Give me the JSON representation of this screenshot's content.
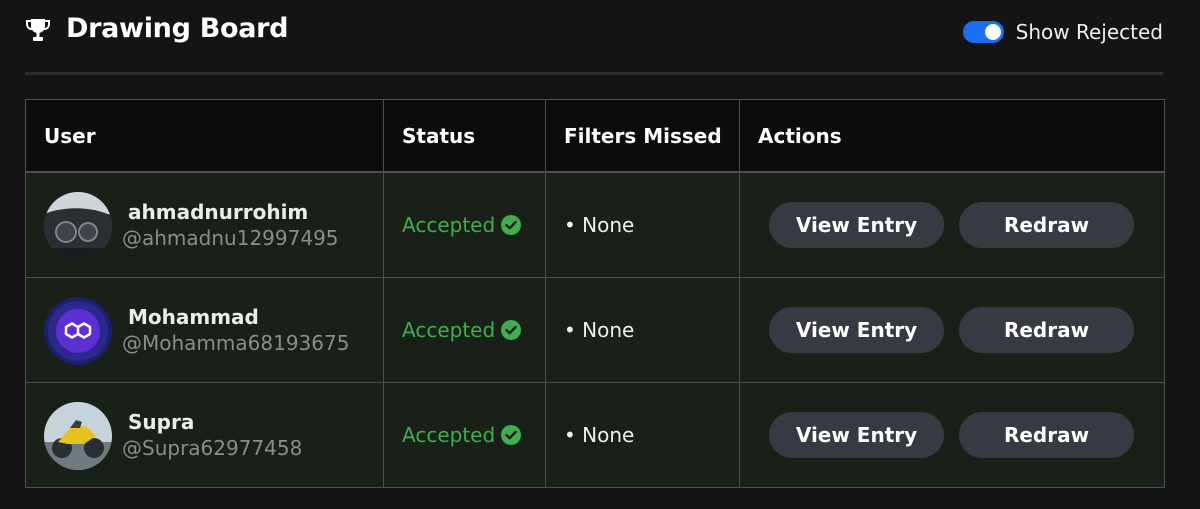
{
  "header": {
    "title": "Drawing Board",
    "toggle_label": "Show Rejected",
    "toggle_on": true
  },
  "table": {
    "columns": [
      "User",
      "Status",
      "Filters Missed",
      "Actions"
    ],
    "rows": [
      {
        "name": "ahmadnurrohim",
        "handle": "@ahmadnu12997495",
        "status": "Accepted",
        "filters": "• None",
        "view_label": "View Entry",
        "redraw_label": "Redraw"
      },
      {
        "name": "Mohammad",
        "handle": "@Mohamma68193675",
        "status": "Accepted",
        "filters": "• None",
        "view_label": "View Entry",
        "redraw_label": "Redraw"
      },
      {
        "name": "Supra",
        "handle": "@Supra62977458",
        "status": "Accepted",
        "filters": "• None",
        "view_label": "View Entry",
        "redraw_label": "Redraw"
      }
    ]
  },
  "colors": {
    "background": "#141414",
    "accent_toggle": "#1c6ff5",
    "status_accepted": "#3fae4f",
    "row_background": "#182018",
    "button_background": "#373a43"
  },
  "icons": {
    "header": "trophy-icon",
    "status": "check-circle-icon"
  }
}
